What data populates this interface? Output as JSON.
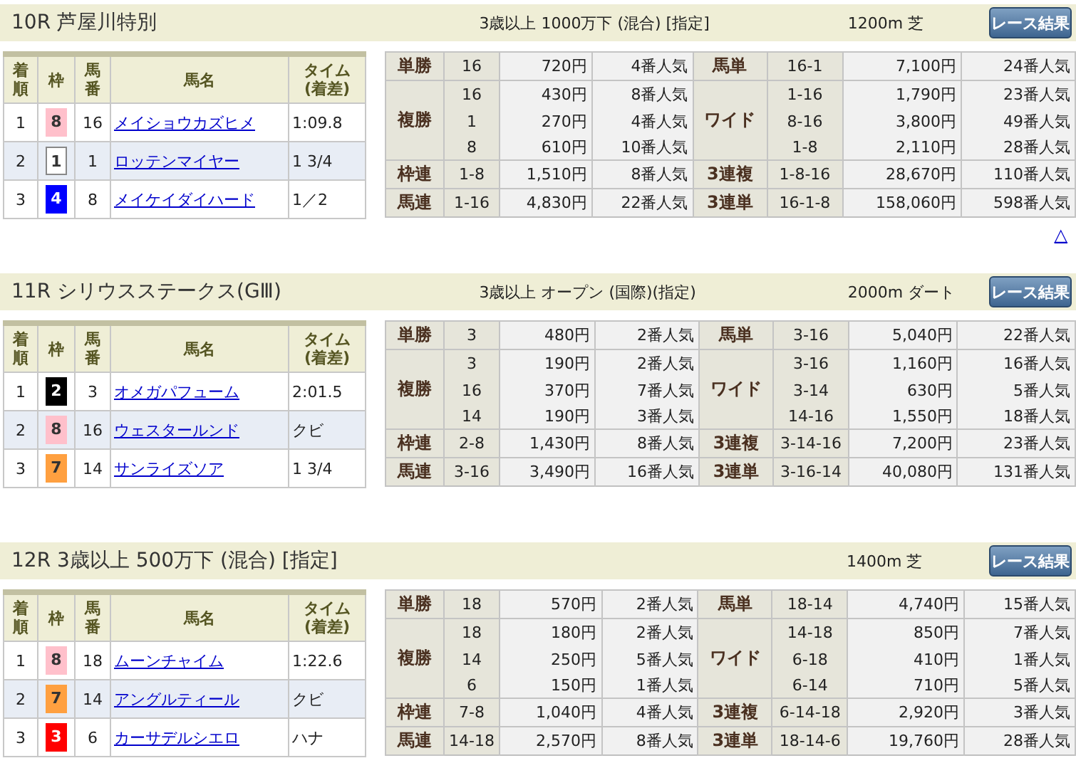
{
  "races": [
    {
      "title": "10R 芦屋川特別",
      "conditions": "3歳以上 1000万下 (混合) [指定]",
      "course": "1200m  芝",
      "button": "レース結果",
      "top_link": "△",
      "columns": [
        "着順",
        "枠",
        "馬番",
        "馬名",
        "タイム\n(着差)"
      ],
      "results": [
        {
          "rank": "1",
          "frame": "8",
          "color": "#ffc0cb",
          "number": "16",
          "horse": "メイショウカズヒメ",
          "time": "1:09.8"
        },
        {
          "rank": "2",
          "frame": "1",
          "color": "#ffffff",
          "number": "1",
          "horse": "ロッテンマイヤー",
          "time": "1 3/4"
        },
        {
          "rank": "3",
          "frame": "4",
          "color": "#0000ff",
          "number": "8",
          "horse": "メイケイダイハード",
          "time": "1／2"
        }
      ],
      "payouts": [
        {
          "left": {
            "bet": "単勝",
            "entries": [
              [
                "16",
                "720円",
                "4番人気"
              ]
            ]
          },
          "right": {
            "bet": "馬単",
            "entries": [
              [
                "16-1",
                "7,100円",
                "24番人気"
              ]
            ]
          }
        },
        {
          "left": {
            "bet": "複勝",
            "entries": [
              [
                "16",
                "430円",
                "8番人気"
              ],
              [
                "1",
                "270円",
                "4番人気"
              ],
              [
                "8",
                "610円",
                "10番人気"
              ]
            ]
          },
          "right": {
            "bet": "ワイド",
            "entries": [
              [
                "1-16",
                "1,790円",
                "23番人気"
              ],
              [
                "8-16",
                "3,800円",
                "49番人気"
              ],
              [
                "1-8",
                "2,110円",
                "28番人気"
              ]
            ]
          }
        },
        {
          "left": {
            "bet": "枠連",
            "entries": [
              [
                "1-8",
                "1,510円",
                "8番人気"
              ]
            ]
          },
          "right": {
            "bet": "3連複",
            "entries": [
              [
                "1-8-16",
                "28,670円",
                "110番人気"
              ]
            ]
          }
        },
        {
          "left": {
            "bet": "馬連",
            "entries": [
              [
                "1-16",
                "4,830円",
                "22番人気"
              ]
            ]
          },
          "right": {
            "bet": "3連単",
            "entries": [
              [
                "16-1-8",
                "158,060円",
                "598番人気"
              ]
            ]
          }
        }
      ]
    },
    {
      "title": "11R シリウスステークス(GⅢ)",
      "conditions": "3歳以上 オープン (国際)(指定)",
      "course": "2000m  ダート",
      "button": "レース結果",
      "columns": [
        "着順",
        "枠",
        "馬番",
        "馬名",
        "タイム\n(着差)"
      ],
      "results": [
        {
          "rank": "1",
          "frame": "2",
          "color": "#000000",
          "number": "3",
          "horse": "オメガパフューム",
          "time": "2:01.5"
        },
        {
          "rank": "2",
          "frame": "8",
          "color": "#ffc0cb",
          "number": "16",
          "horse": "ウェスタールンド",
          "time": "クビ"
        },
        {
          "rank": "3",
          "frame": "7",
          "color": "#ffa040",
          "number": "14",
          "horse": "サンライズソア",
          "time": "1 3/4"
        }
      ],
      "payouts": [
        {
          "left": {
            "bet": "単勝",
            "entries": [
              [
                "3",
                "480円",
                "2番人気"
              ]
            ]
          },
          "right": {
            "bet": "馬単",
            "entries": [
              [
                "3-16",
                "5,040円",
                "22番人気"
              ]
            ]
          }
        },
        {
          "left": {
            "bet": "複勝",
            "entries": [
              [
                "3",
                "190円",
                "2番人気"
              ],
              [
                "16",
                "370円",
                "7番人気"
              ],
              [
                "14",
                "190円",
                "3番人気"
              ]
            ]
          },
          "right": {
            "bet": "ワイド",
            "entries": [
              [
                "3-16",
                "1,160円",
                "16番人気"
              ],
              [
                "3-14",
                "630円",
                "5番人気"
              ],
              [
                "14-16",
                "1,550円",
                "18番人気"
              ]
            ]
          }
        },
        {
          "left": {
            "bet": "枠連",
            "entries": [
              [
                "2-8",
                "1,430円",
                "8番人気"
              ]
            ]
          },
          "right": {
            "bet": "3連複",
            "entries": [
              [
                "3-14-16",
                "7,200円",
                "23番人気"
              ]
            ]
          }
        },
        {
          "left": {
            "bet": "馬連",
            "entries": [
              [
                "3-16",
                "3,490円",
                "16番人気"
              ]
            ]
          },
          "right": {
            "bet": "3連単",
            "entries": [
              [
                "3-16-14",
                "40,080円",
                "131番人気"
              ]
            ]
          }
        }
      ]
    },
    {
      "title": "12R 3歳以上 500万下 (混合) [指定]",
      "course": "1400m  芝",
      "button": "レース結果",
      "columns": [
        "着順",
        "枠",
        "馬番",
        "馬名",
        "タイム\n(着差)"
      ],
      "results": [
        {
          "rank": "1",
          "frame": "8",
          "color": "#ffc0cb",
          "number": "18",
          "horse": "ムーンチャイム",
          "time": "1:22.6"
        },
        {
          "rank": "2",
          "frame": "7",
          "color": "#ffa040",
          "number": "14",
          "horse": "アングルティール",
          "time": "クビ"
        },
        {
          "rank": "3",
          "frame": "3",
          "color": "#ff0000",
          "number": "6",
          "horse": "カーサデルシエロ",
          "time": "ハナ"
        }
      ],
      "payouts": [
        {
          "left": {
            "bet": "単勝",
            "entries": [
              [
                "18",
                "570円",
                "2番人気"
              ]
            ]
          },
          "right": {
            "bet": "馬単",
            "entries": [
              [
                "18-14",
                "4,740円",
                "15番人気"
              ]
            ]
          }
        },
        {
          "left": {
            "bet": "複勝",
            "entries": [
              [
                "18",
                "180円",
                "2番人気"
              ],
              [
                "14",
                "250円",
                "5番人気"
              ],
              [
                "6",
                "150円",
                "1番人気"
              ]
            ]
          },
          "right": {
            "bet": "ワイド",
            "entries": [
              [
                "14-18",
                "850円",
                "7番人気"
              ],
              [
                "6-18",
                "410円",
                "1番人気"
              ],
              [
                "6-14",
                "710円",
                "5番人気"
              ]
            ]
          }
        },
        {
          "left": {
            "bet": "枠連",
            "entries": [
              [
                "7-8",
                "1,040円",
                "4番人気"
              ]
            ]
          },
          "right": {
            "bet": "3連複",
            "entries": [
              [
                "6-14-18",
                "2,920円",
                "3番人気"
              ]
            ]
          }
        },
        {
          "left": {
            "bet": "馬連",
            "entries": [
              [
                "14-18",
                "2,570円",
                "8番人気"
              ]
            ]
          },
          "right": {
            "bet": "3連単",
            "entries": [
              [
                "18-14-6",
                "19,760円",
                "28番人気"
              ]
            ]
          }
        }
      ]
    }
  ]
}
